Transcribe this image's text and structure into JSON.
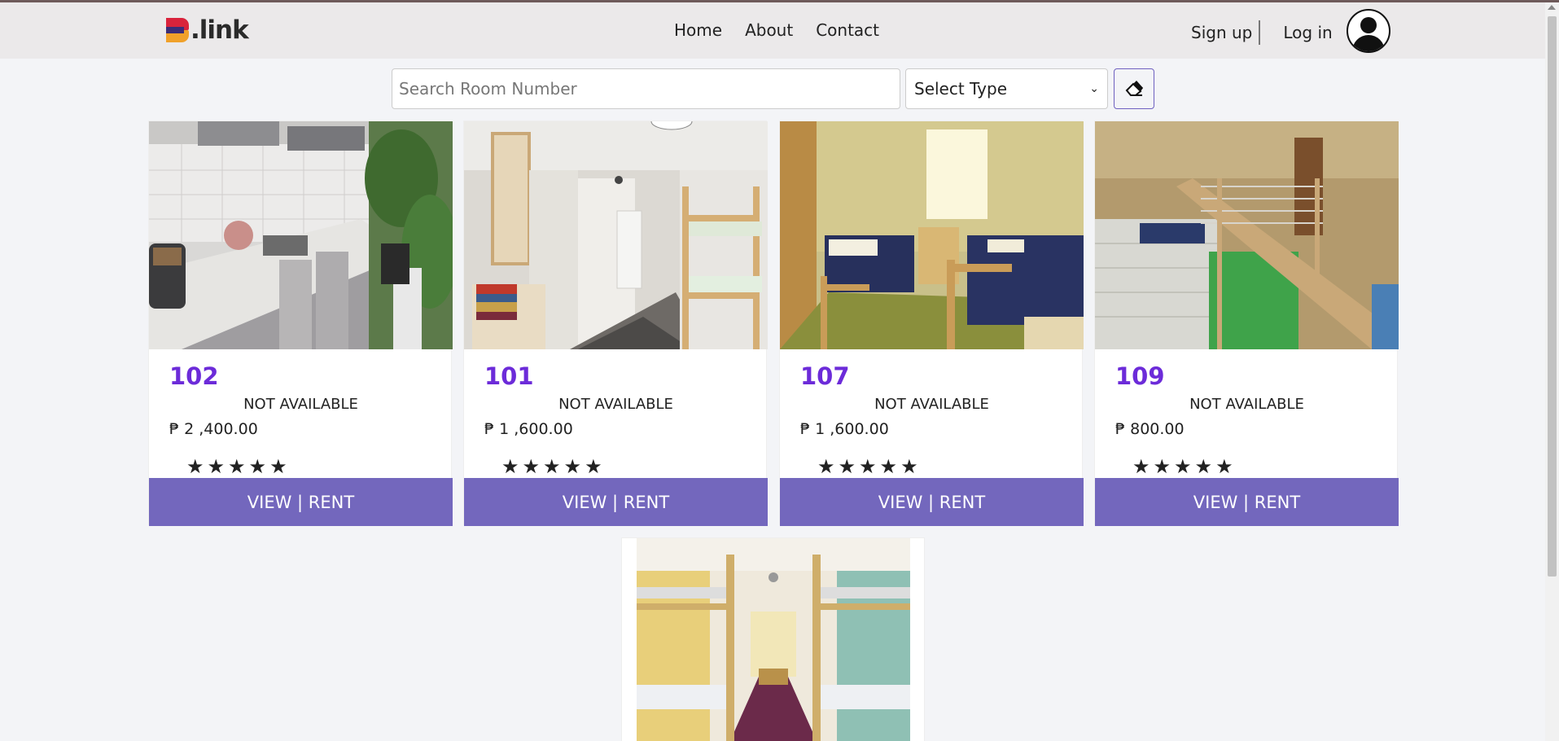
{
  "brand": {
    "name": ".link"
  },
  "nav": {
    "links": [
      "Home",
      "About",
      "Contact"
    ]
  },
  "auth": {
    "signup": "Sign up",
    "login": "Log in"
  },
  "filters": {
    "search_placeholder": "Search Room Number",
    "select_value": "Select Type"
  },
  "rooms": [
    {
      "number": "102",
      "status": "NOT AVAILABLE",
      "price": "₱ 2 ,400.00",
      "rating": 5,
      "action": "VIEW | RENT",
      "image": "kitchen"
    },
    {
      "number": "101",
      "status": "NOT AVAILABLE",
      "price": "₱ 1 ,600.00",
      "rating": 5,
      "action": "VIEW | RENT",
      "image": "bunk-bedroom"
    },
    {
      "number": "107",
      "status": "NOT AVAILABLE",
      "price": "₱ 1 ,600.00",
      "rating": 5,
      "action": "VIEW | RENT",
      "image": "twin-bedroom"
    },
    {
      "number": "109",
      "status": "NOT AVAILABLE",
      "price": "₱ 800.00",
      "rating": 5,
      "action": "VIEW | RENT",
      "image": "stairway"
    }
  ],
  "next_room": {
    "image": "bunk-dorm"
  },
  "colors": {
    "accent": "#7367bd",
    "room_number": "#6c2bd9",
    "navbar": "#ebe9ea",
    "background": "#f3f4f7"
  }
}
